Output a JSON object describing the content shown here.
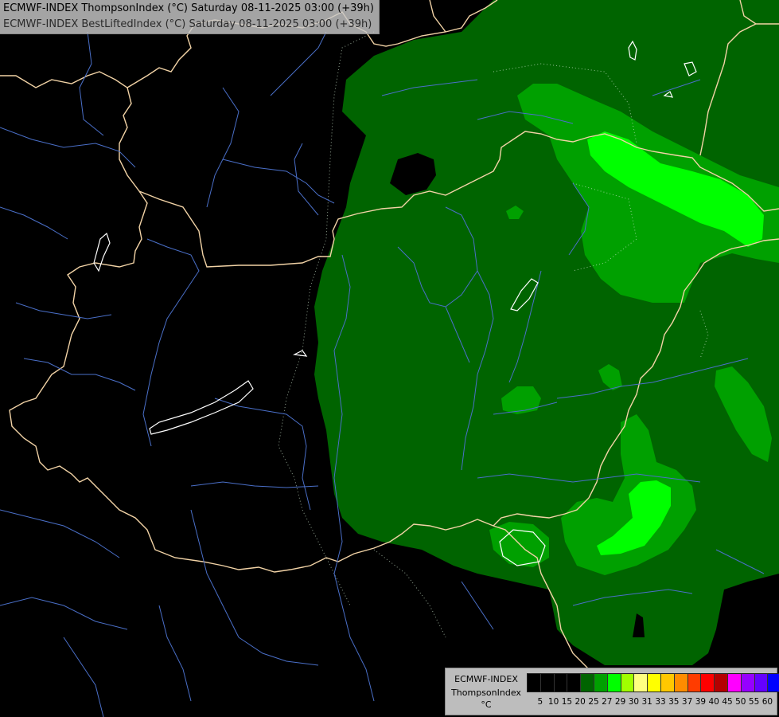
{
  "header": {
    "line1": "ECMWF-INDEX ThompsonIndex (°C) Saturday 08-11-2025 03:00 (+39h)",
    "line2": "ECMWF-INDEX BestLiftedIndex (°C) Saturday 08-11-2025 03:00 (+39h)"
  },
  "legend": {
    "source": "ECMWF-INDEX",
    "parameter": "ThompsonIndex",
    "unit": "°C",
    "ticks": [
      "5",
      "10",
      "15",
      "20",
      "25",
      "27",
      "29",
      "30",
      "31",
      "33",
      "35",
      "37",
      "39",
      "40",
      "45",
      "50",
      "55",
      "60"
    ],
    "colors": [
      "#000000",
      "#000000",
      "#000000",
      "#000000",
      "#006400",
      "#00a000",
      "#00ff00",
      "#a0ff00",
      "#ffff80",
      "#ffff00",
      "#ffc800",
      "#ff8c00",
      "#ff3c00",
      "#ff0000",
      "#b40000",
      "#ff00ff",
      "#9600ff",
      "#6400ff",
      "#0000ff"
    ]
  },
  "map": {
    "colors": {
      "background": "#000000",
      "index_20_25": "#006400",
      "index_25_27": "#00a000",
      "index_27_29": "#00ff00",
      "borders": "#f5d5a5",
      "rivers": "#4a6fc8",
      "lakes": "#ffffff"
    }
  }
}
